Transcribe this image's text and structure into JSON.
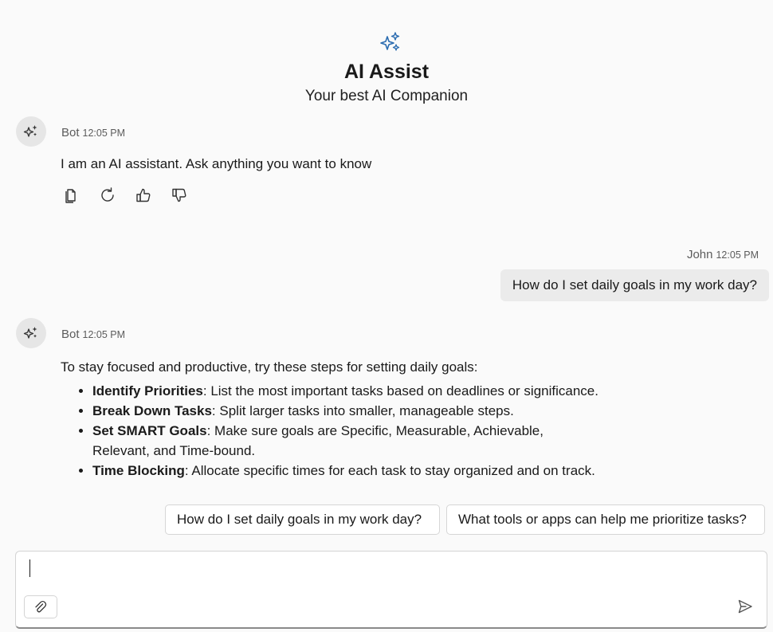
{
  "header": {
    "title": "AI Assist",
    "subtitle": "Your best AI Companion",
    "logo_icon": "sparkles-icon",
    "accent_color": "#2b6cb0"
  },
  "messages": [
    {
      "sender": "Bot",
      "time": "12:05 PM",
      "text": "I am an AI assistant. Ask anything you want to know",
      "actions": [
        "copy-icon",
        "regenerate-icon",
        "thumbs-up-icon",
        "thumbs-down-icon"
      ]
    },
    {
      "sender": "John",
      "time": "12:05 PM",
      "text": "How do I set daily goals in my work day?"
    },
    {
      "sender": "Bot",
      "time": "12:05 PM",
      "intro": "To stay focused and productive, try these steps for setting daily goals:",
      "items": [
        {
          "bold": "Identify Priorities",
          "text": ": List the most important tasks based on deadlines or significance."
        },
        {
          "bold": "Break Down Tasks",
          "text": ": Split larger tasks into smaller, manageable steps."
        },
        {
          "bold": "Set SMART Goals",
          "text": ": Make sure goals are Specific, Measurable, Achievable, Relevant, and Time-bound."
        },
        {
          "bold": "Time Blocking",
          "text": ": Allocate specific times for each task to stay organized and on track."
        }
      ]
    }
  ],
  "suggestions": [
    "How do I set daily goals in my work day?",
    "What tools or apps can help me prioritize tasks?"
  ],
  "composer": {
    "value": "",
    "attach_icon": "paperclip-icon",
    "send_icon": "send-icon"
  }
}
